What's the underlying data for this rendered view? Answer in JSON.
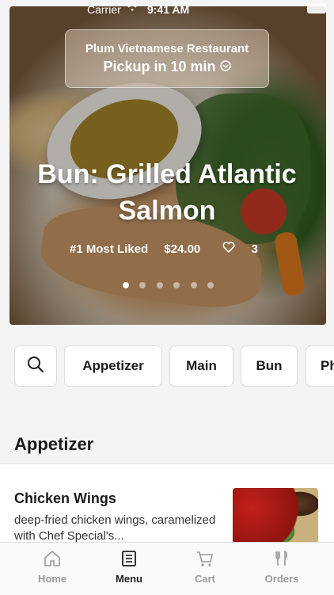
{
  "status_bar": {
    "carrier": "Carrier",
    "time": "9:41 AM"
  },
  "hero": {
    "restaurant": "Plum Vietnamese Restaurant",
    "pickup": "Pickup in 10 min",
    "dish_title": "Bun: Grilled Atlantic Salmon",
    "rank": "#1 Most Liked",
    "price": "$24.00",
    "likes": "3",
    "carousel_pages": 6,
    "active_page": 1
  },
  "categories": [
    "Appetizer",
    "Main",
    "Bun",
    "Ph"
  ],
  "section": {
    "title": "Appetizer"
  },
  "items": [
    {
      "name": "Chicken Wings",
      "description": "deep-fried chicken wings, caramelized with Chef Special's..."
    }
  ],
  "tabs": [
    {
      "label": "Home",
      "icon": "home-icon",
      "active": false
    },
    {
      "label": "Menu",
      "icon": "menu-book-icon",
      "active": true
    },
    {
      "label": "Cart",
      "icon": "cart-icon",
      "active": false
    },
    {
      "label": "Orders",
      "icon": "fork-knife-icon",
      "active": false
    }
  ],
  "colors": {
    "active_tab": "#1f1f1f",
    "inactive_tab": "#9a9a9a",
    "card_border": "#dcdcdc"
  }
}
